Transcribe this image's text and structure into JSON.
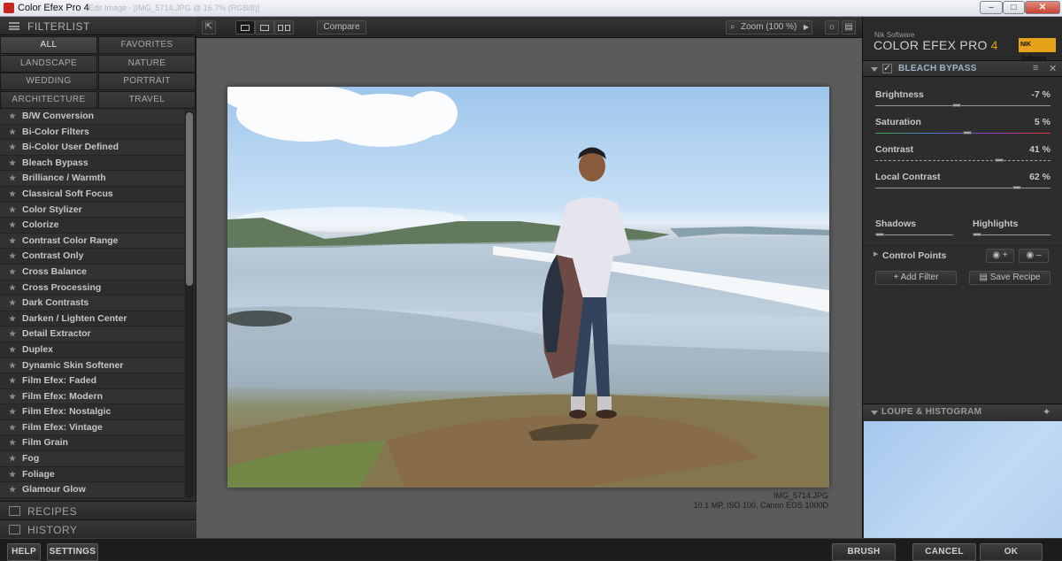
{
  "window": {
    "title": "Color Efex Pro 4",
    "ghost_text": "Edit Image - [IMG_5714.JPG @ 16.7% (RGB/8)]"
  },
  "filterlist": {
    "header": "FILTERLIST",
    "categories": [
      "ALL",
      "FAVORITES",
      "LANDSCAPE",
      "NATURE",
      "WEDDING",
      "PORTRAIT",
      "ARCHITECTURE",
      "TRAVEL"
    ],
    "active_category": "ALL",
    "filters": [
      "B/W Conversion",
      "Bi-Color Filters",
      "Bi-Color User Defined",
      "Bleach Bypass",
      "Brilliance / Warmth",
      "Classical Soft Focus",
      "Color Stylizer",
      "Colorize",
      "Contrast Color Range",
      "Contrast Only",
      "Cross Balance",
      "Cross Processing",
      "Dark Contrasts",
      "Darken / Lighten Center",
      "Detail Extractor",
      "Duplex",
      "Dynamic Skin Softener",
      "Film Efex: Faded",
      "Film Efex: Modern",
      "Film Efex: Nostalgic",
      "Film Efex: Vintage",
      "Film Grain",
      "Fog",
      "Foliage",
      "Glamour Glow"
    ],
    "recipes_label": "RECIPES",
    "history_label": "HISTORY"
  },
  "toolbar": {
    "compare_label": "Compare",
    "zoom_label": "Zoom (100 %)"
  },
  "image": {
    "filename": "IMG_5714.JPG",
    "info": "10.1 MP, ISO 100, Canon EOS 1000D"
  },
  "brand": {
    "vendor": "Nik Software",
    "product": "COLOR EFEX PRO",
    "version": "4",
    "logo_text": "NIK Software"
  },
  "filter_panel": {
    "title": "BLEACH BYPASS",
    "checked": "✓",
    "sliders": [
      {
        "label": "Brightness",
        "value": -7,
        "display": "-7  %"
      },
      {
        "label": "Saturation",
        "value": 5,
        "display": "5  %"
      },
      {
        "label": "Contrast",
        "value": 41,
        "display": "41  %"
      },
      {
        "label": "Local Contrast",
        "value": 62,
        "display": "62  %"
      }
    ],
    "shadows_label": "Shadows",
    "highlights_label": "Highlights",
    "control_points_label": "Control Points",
    "add_filter_label": "Add Filter",
    "save_recipe_label": "Save Recipe"
  },
  "loupe": {
    "title": "LOUPE & HISTOGRAM"
  },
  "bottom": {
    "help_label": "HELP",
    "settings_label": "SETTINGS",
    "brush_label": "BRUSH",
    "cancel_label": "CANCEL",
    "ok_label": "OK"
  },
  "colors": {
    "accent": "#e0a000",
    "panel_bg": "#2b2b2b",
    "canvas_bg": "#5b5b5b"
  }
}
